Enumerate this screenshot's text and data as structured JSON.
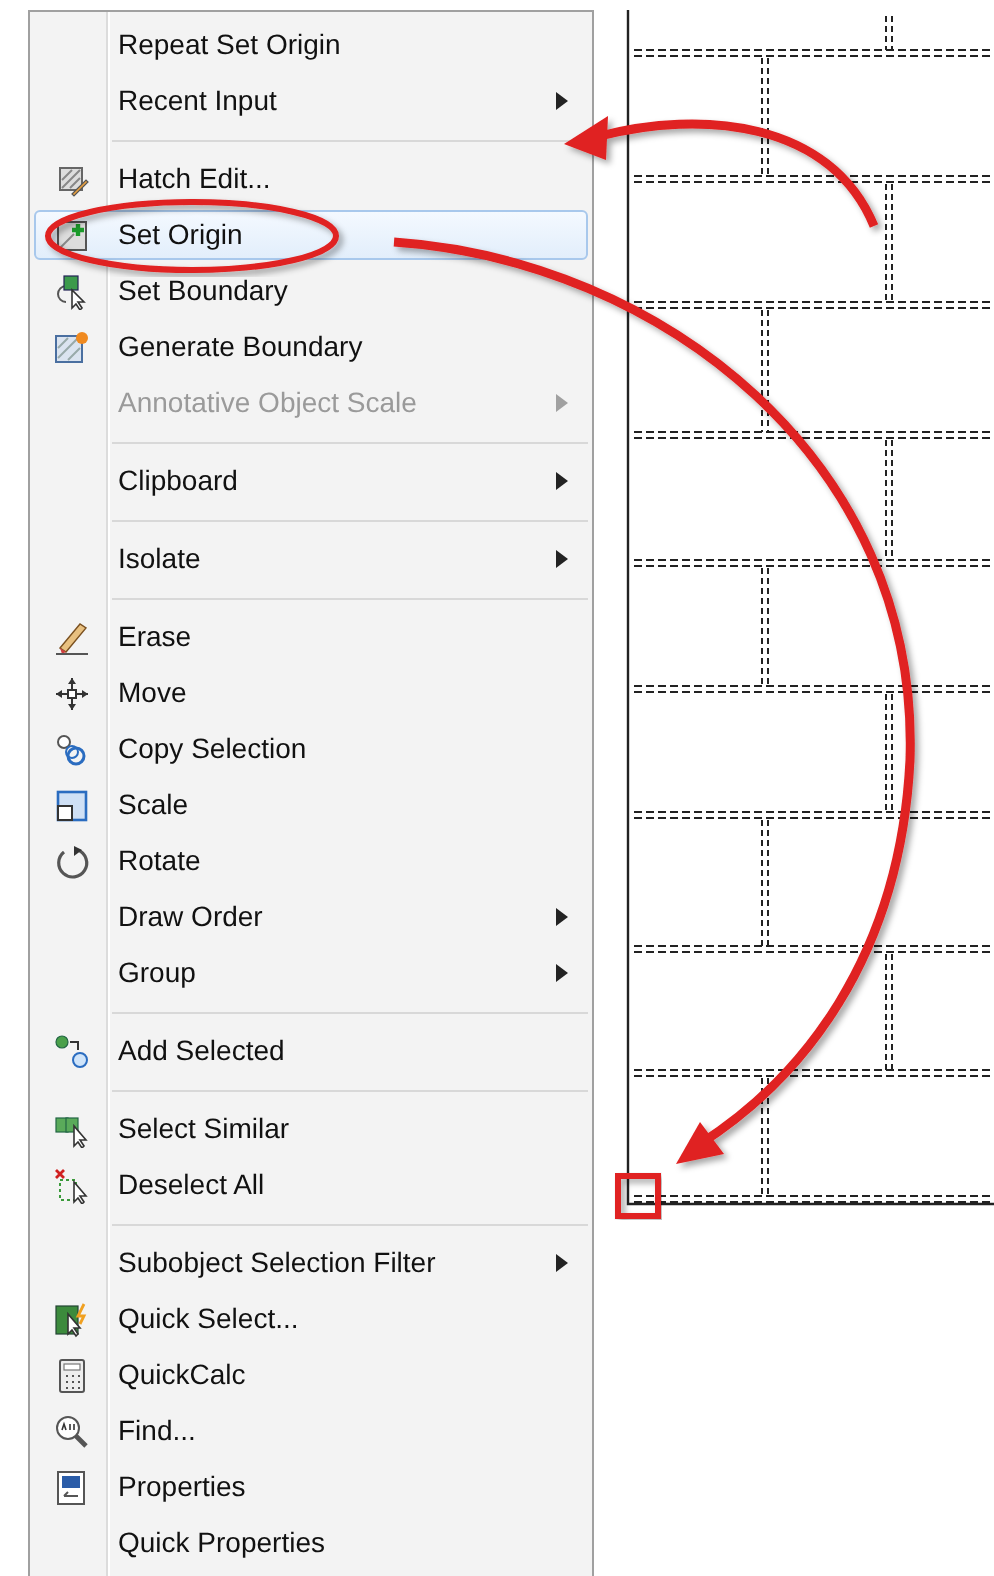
{
  "context_menu": {
    "sections": [
      {
        "items": [
          {
            "label": "Repeat Set Origin",
            "submenu": false,
            "disabled": false,
            "selected": false
          },
          {
            "label": "Recent Input",
            "submenu": true,
            "disabled": false,
            "selected": false
          }
        ]
      },
      {
        "items": [
          {
            "label": "Hatch Edit...",
            "submenu": false,
            "disabled": false,
            "selected": false
          },
          {
            "label": "Set Origin",
            "submenu": false,
            "disabled": false,
            "selected": true
          },
          {
            "label": "Set Boundary",
            "submenu": false,
            "disabled": false,
            "selected": false
          },
          {
            "label": "Generate Boundary",
            "submenu": false,
            "disabled": false,
            "selected": false
          },
          {
            "label": "Annotative Object Scale",
            "submenu": true,
            "disabled": true,
            "selected": false
          }
        ]
      },
      {
        "items": [
          {
            "label": "Clipboard",
            "submenu": true,
            "disabled": false,
            "selected": false
          }
        ]
      },
      {
        "items": [
          {
            "label": "Isolate",
            "submenu": true,
            "disabled": false,
            "selected": false
          }
        ]
      },
      {
        "items": [
          {
            "label": "Erase",
            "submenu": false,
            "disabled": false,
            "selected": false
          },
          {
            "label": "Move",
            "submenu": false,
            "disabled": false,
            "selected": false
          },
          {
            "label": "Copy Selection",
            "submenu": false,
            "disabled": false,
            "selected": false
          },
          {
            "label": "Scale",
            "submenu": false,
            "disabled": false,
            "selected": false
          },
          {
            "label": "Rotate",
            "submenu": false,
            "disabled": false,
            "selected": false
          },
          {
            "label": "Draw Order",
            "submenu": true,
            "disabled": false,
            "selected": false
          },
          {
            "label": "Group",
            "submenu": true,
            "disabled": false,
            "selected": false
          }
        ]
      },
      {
        "items": [
          {
            "label": "Add Selected",
            "submenu": false,
            "disabled": false,
            "selected": false
          }
        ]
      },
      {
        "items": [
          {
            "label": "Select Similar",
            "submenu": false,
            "disabled": false,
            "selected": false
          },
          {
            "label": "Deselect All",
            "submenu": false,
            "disabled": false,
            "selected": false
          }
        ]
      },
      {
        "items": [
          {
            "label": "Subobject Selection Filter",
            "submenu": true,
            "disabled": false,
            "selected": false
          },
          {
            "label": "Quick Select...",
            "submenu": false,
            "disabled": false,
            "selected": false
          },
          {
            "label": "QuickCalc",
            "submenu": false,
            "disabled": false,
            "selected": false
          },
          {
            "label": "Find...",
            "submenu": false,
            "disabled": false,
            "selected": false
          },
          {
            "label": "Properties",
            "submenu": false,
            "disabled": false,
            "selected": false
          },
          {
            "label": "Quick Properties",
            "submenu": false,
            "disabled": false,
            "selected": false
          }
        ]
      }
    ]
  }
}
